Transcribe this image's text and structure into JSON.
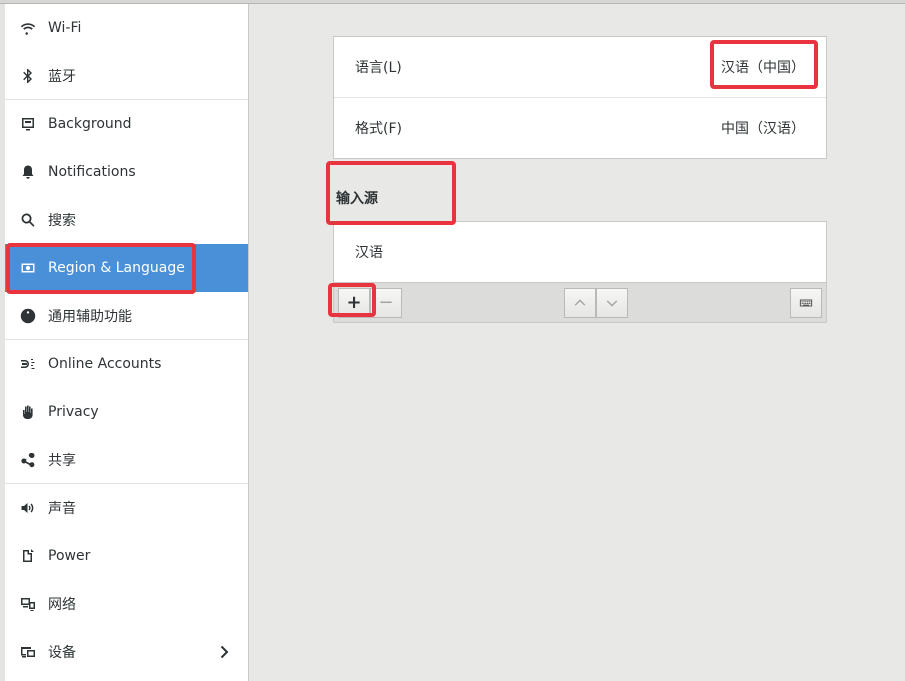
{
  "sidebar": {
    "items": [
      {
        "label": "Wi-Fi",
        "icon": "wifi-icon"
      },
      {
        "label": "蓝牙",
        "icon": "bluetooth-icon"
      },
      {
        "label": "Background",
        "icon": "background-icon"
      },
      {
        "label": "Notifications",
        "icon": "bell-icon"
      },
      {
        "label": "搜索",
        "icon": "search-icon"
      },
      {
        "label": "Region & Language",
        "icon": "region-icon",
        "active": true
      },
      {
        "label": "通用辅助功能",
        "icon": "accessibility-icon"
      },
      {
        "label": "Online Accounts",
        "icon": "online-accounts-icon"
      },
      {
        "label": "Privacy",
        "icon": "hand-icon"
      },
      {
        "label": "共享",
        "icon": "share-icon"
      },
      {
        "label": "声音",
        "icon": "speaker-icon"
      },
      {
        "label": "Power",
        "icon": "power-icon"
      },
      {
        "label": "网络",
        "icon": "network-icon"
      },
      {
        "label": "设备",
        "icon": "devices-icon"
      }
    ]
  },
  "main": {
    "language_label": "语言(L)",
    "language_value": "汉语（中国）",
    "formats_label": "格式(F)",
    "formats_value": "中国（汉语）",
    "input_sources_title": "输入源",
    "input_sources": [
      "汉语"
    ],
    "toolbar": {
      "add": "+",
      "remove": "−"
    }
  },
  "colors": {
    "accent": "#4a90d9",
    "highlight": "#e8343f",
    "background": "#e8e8e7"
  }
}
